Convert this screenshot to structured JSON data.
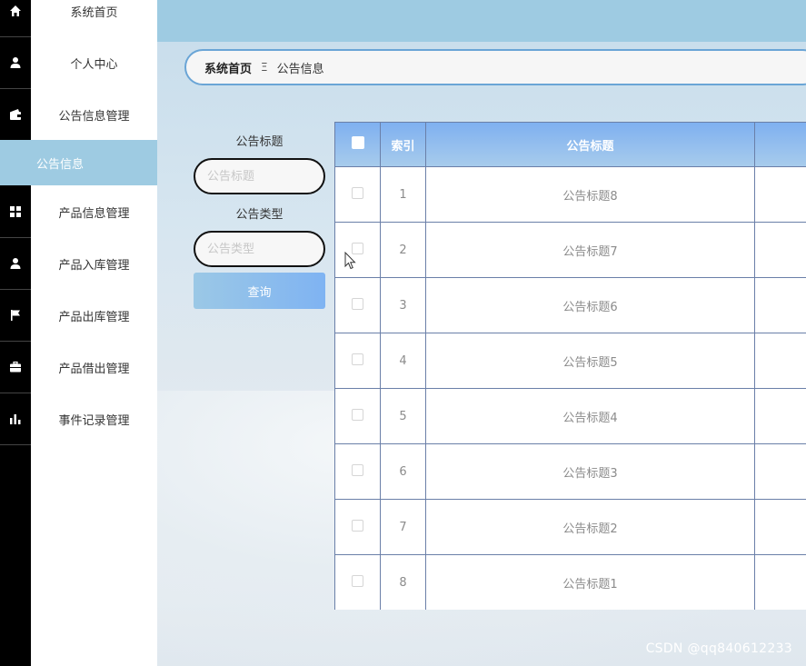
{
  "sidebar": {
    "items": [
      {
        "label": "系统首页",
        "icon": "home-icon"
      },
      {
        "label": "个人中心",
        "icon": "user-icon"
      },
      {
        "label": "公告信息管理",
        "icon": "wallet-icon"
      },
      {
        "label": "产品信息管理",
        "icon": "grid-icon"
      },
      {
        "label": "产品入库管理",
        "icon": "user-icon"
      },
      {
        "label": "产品出库管理",
        "icon": "flag-icon"
      },
      {
        "label": "产品借出管理",
        "icon": "briefcase-icon"
      },
      {
        "label": "事件记录管理",
        "icon": "bar-chart-icon"
      }
    ],
    "active_sub": "公告信息"
  },
  "breadcrumb": {
    "home": "系统首页",
    "separator": "Ξ",
    "current": "公告信息"
  },
  "search": {
    "title_label": "公告标题",
    "title_placeholder": "公告标题",
    "type_label": "公告类型",
    "type_placeholder": "公告类型",
    "query_button": "查询"
  },
  "table": {
    "headers": [
      "",
      "索引",
      "公告标题",
      ""
    ],
    "rows": [
      {
        "index": "1",
        "title": "公告标题8"
      },
      {
        "index": "2",
        "title": "公告标题7"
      },
      {
        "index": "3",
        "title": "公告标题6"
      },
      {
        "index": "4",
        "title": "公告标题5"
      },
      {
        "index": "5",
        "title": "公告标题4"
      },
      {
        "index": "6",
        "title": "公告标题3"
      },
      {
        "index": "7",
        "title": "公告标题2"
      },
      {
        "index": "8",
        "title": "公告标题1"
      }
    ]
  },
  "watermark": "CSDN @qq840612233",
  "colors": {
    "accent": "#9ecbe2",
    "header_gradient_start": "#7fb0f0",
    "sidebar_rail": "#000000"
  }
}
